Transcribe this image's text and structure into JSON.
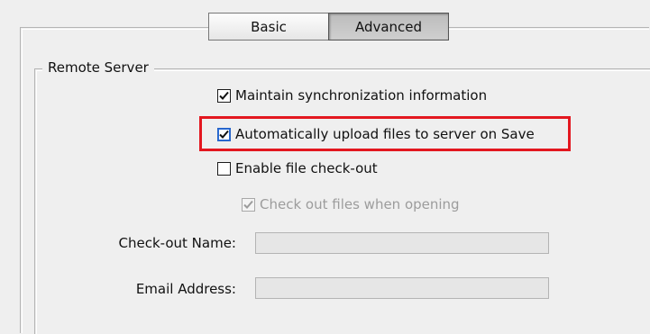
{
  "tabs": [
    {
      "label": "Basic",
      "selected": false
    },
    {
      "label": "Advanced",
      "selected": true
    }
  ],
  "group": {
    "title": "Remote Server"
  },
  "options": [
    {
      "label": "Maintain synchronization information",
      "checked": true,
      "enabled": true,
      "focused": false
    },
    {
      "label": "Automatically upload files to server on Save",
      "checked": true,
      "enabled": true,
      "focused": true,
      "highlighted": true
    },
    {
      "label": "Enable file check-out",
      "checked": false,
      "enabled": true,
      "focused": false
    },
    {
      "label": "Check out files when opening",
      "checked": true,
      "enabled": false,
      "focused": false
    }
  ],
  "fields": {
    "checkout_name": {
      "label": "Check-out Name:",
      "value": "",
      "enabled": false
    },
    "email_address": {
      "label": "Email Address:",
      "value": "",
      "enabled": false
    }
  },
  "colors": {
    "background": "#efefef",
    "highlight_border": "#e3171f",
    "focus_border": "#2462c7",
    "disabled_text": "#9c9c9c"
  },
  "icons": {
    "check": "checkmark-icon"
  }
}
